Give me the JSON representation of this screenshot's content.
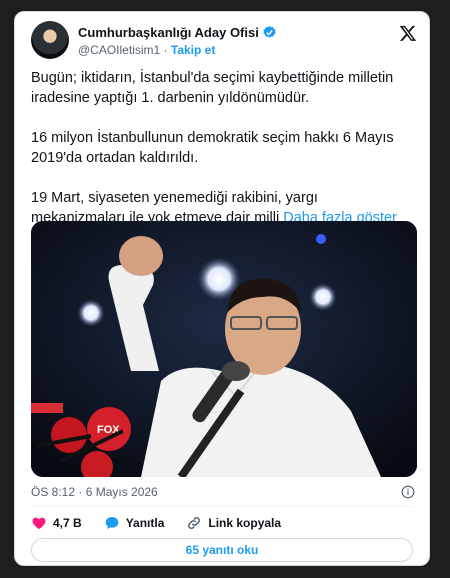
{
  "author": {
    "name": "Cumhurbaşkanlığı Aday Ofisi",
    "handle": "@CAOIletisim1",
    "separator": "·",
    "follow_label": "Takip et"
  },
  "tweet": {
    "paragraphs": [
      "Bugün; iktidarın, İstanbul'da seçimi kaybettiğinde milletin iradesine yaptığı 1. darbenin yıldönümüdür.",
      "16 milyon İstanbullunun demokratik seçim hakkı 6 Mayıs 2019'da ortadan kaldırıldı.",
      "19 Mart, siyaseten yenemediği rakibini, yargı mekanizmaları ile yok etmeye dair milli"
    ],
    "show_more": "Daha fazla göster",
    "timestamp": "ÖS 8:12 · 6 Mayıs 2026"
  },
  "actions": {
    "likes": "4,7 B",
    "reply_label": "Yanıtla",
    "copy_link_label": "Link kopyala",
    "read_replies": "65 yanıtı oku"
  },
  "colors": {
    "accent": "#1d9bf0",
    "like": "#f91880",
    "text": "#0f1419",
    "muted": "#536471"
  }
}
